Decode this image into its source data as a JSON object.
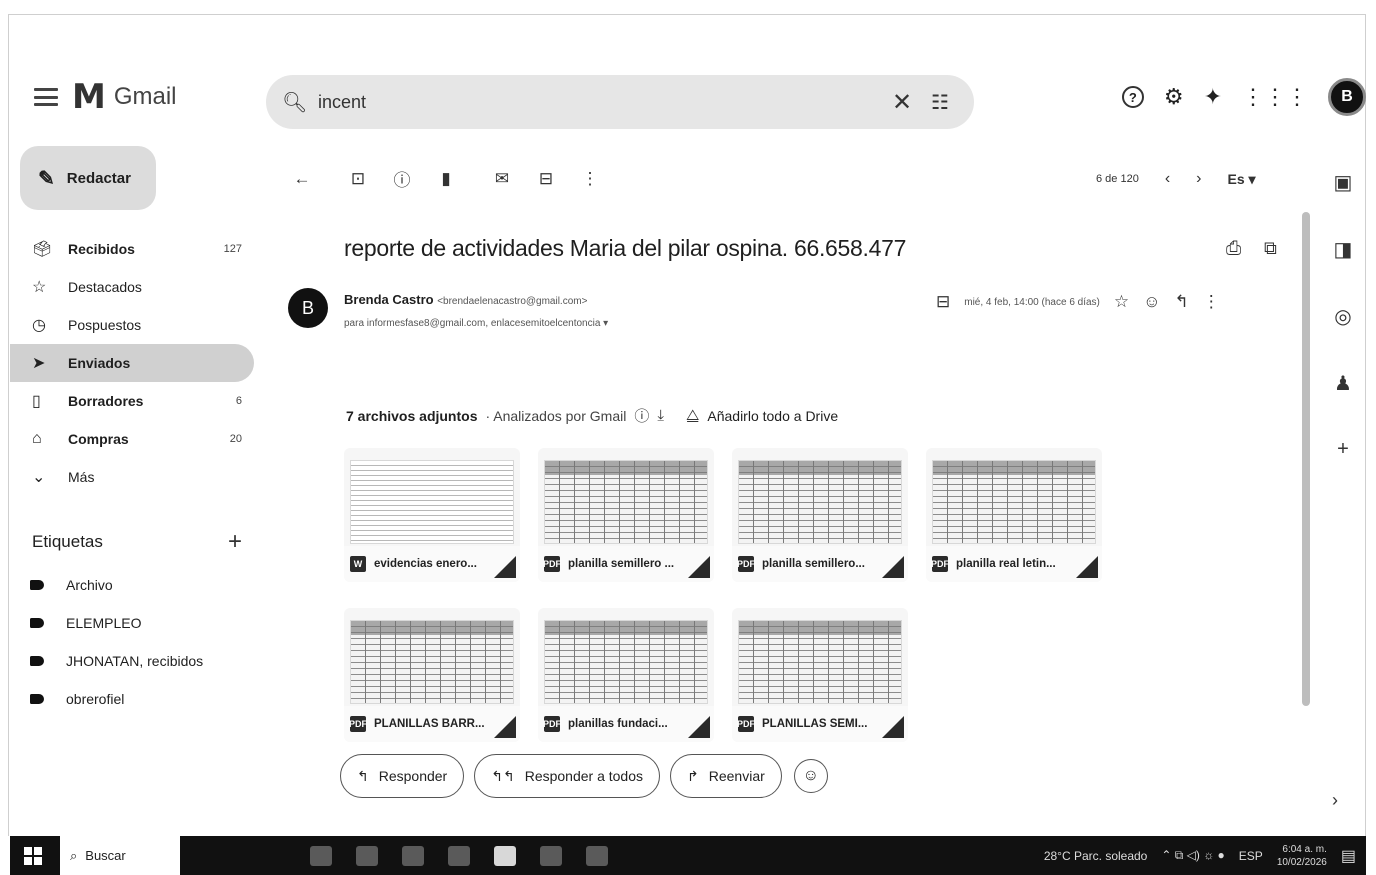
{
  "app": {
    "name": "Gmail"
  },
  "search": {
    "value": "incent"
  },
  "compose": {
    "label": "Redactar"
  },
  "nav": [
    {
      "label": "Recibidos",
      "count": "127",
      "icon": "inbox-icon",
      "glyph": "🗳",
      "bold": true
    },
    {
      "label": "Destacados",
      "count": "",
      "icon": "star-icon",
      "glyph": "☆",
      "bold": false
    },
    {
      "label": "Pospuestos",
      "count": "",
      "icon": "clock-icon",
      "glyph": "◷",
      "bold": false
    },
    {
      "label": "Enviados",
      "count": "",
      "icon": "send-icon",
      "glyph": "➤",
      "bold": true,
      "active": true
    },
    {
      "label": "Borradores",
      "count": "6",
      "icon": "draft-icon",
      "glyph": "▯",
      "bold": true
    },
    {
      "label": "Compras",
      "count": "20",
      "icon": "tag-icon",
      "glyph": "⌂",
      "bold": true
    },
    {
      "label": "Más",
      "count": "",
      "icon": "chevron-down-icon",
      "glyph": "⌄",
      "bold": false
    }
  ],
  "labels": {
    "heading": "Etiquetas",
    "items": [
      "Archivo",
      "ELEMPLEO",
      "JHONATAN, recibidos",
      "obrerofiel"
    ]
  },
  "pager": {
    "position": "6 de 120",
    "language": "Es"
  },
  "email": {
    "subject": "reporte de actividades Maria del pilar ospina. 66.658.477",
    "sender_initial": "B",
    "sender_name": "Brenda Castro",
    "sender_email": "<brendaelenacastro@gmail.com>",
    "recipients": "para informesfase8@gmail.com, enlacesemitoelcentoncia",
    "date": "mié, 4 feb, 14:00 (hace 6 días)"
  },
  "attachments": {
    "count_label": "7 archivos adjuntos",
    "scanned_label": "· Analizados por Gmail",
    "drive_label": "Añadirlo todo a Drive",
    "files": [
      {
        "name": "evidencias enero...",
        "type": "W",
        "kind": "doc"
      },
      {
        "name": "planilla semillero ...",
        "type": "PDF",
        "kind": "sheet"
      },
      {
        "name": "planilla semillero...",
        "type": "PDF",
        "kind": "sheet"
      },
      {
        "name": "planilla real letin...",
        "type": "PDF",
        "kind": "sheet"
      },
      {
        "name": "PLANILLAS BARR...",
        "type": "PDF",
        "kind": "sheet"
      },
      {
        "name": "planillas fundaci...",
        "type": "PDF",
        "kind": "sheet"
      },
      {
        "name": "PLANILLAS SEMI...",
        "type": "PDF",
        "kind": "sheet"
      }
    ]
  },
  "actions": {
    "reply": "Responder",
    "reply_all": "Responder a todos",
    "forward": "Reenviar"
  },
  "taskbar": {
    "search_label": "Buscar",
    "weather": "28°C Parc. soleado",
    "lang": "ESP",
    "time": "6:04 a. m.",
    "date": "10/02/2026"
  }
}
